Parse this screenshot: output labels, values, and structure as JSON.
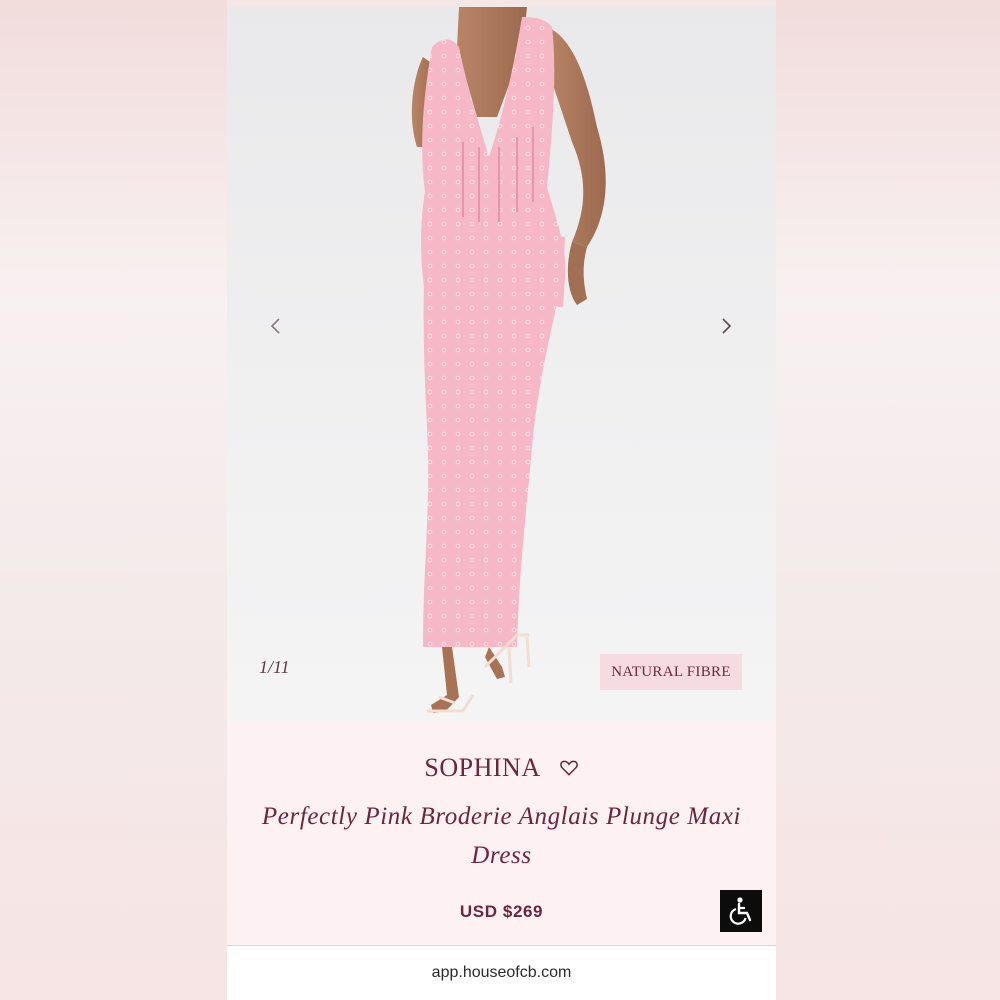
{
  "gallery": {
    "counter": "1/11",
    "badge": "NATURAL FIBRE",
    "prev_icon": "chevron-left-icon",
    "next_icon": "chevron-right-icon"
  },
  "product": {
    "brand": "SOPHINA",
    "title": "Perfectly Pink Broderie Anglais Plunge Maxi Dress",
    "price": "USD $269",
    "wishlist_icon": "heart-icon"
  },
  "accessibility": {
    "icon": "wheelchair-icon"
  },
  "browser": {
    "url": "app.houseofcb.com"
  },
  "colors": {
    "accent": "#6b2540",
    "badge_bg": "#f6dbe2",
    "info_bg": "#fdf1f3",
    "dress_pink": "#f5b8c6"
  }
}
